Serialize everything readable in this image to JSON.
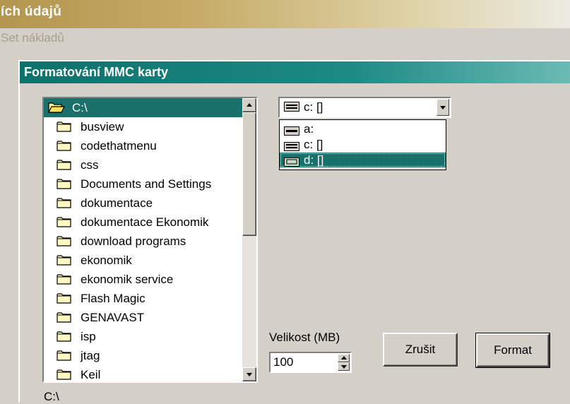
{
  "outer_window": {
    "title": "ích údajů",
    "subtitle": "Set nákladů"
  },
  "dialog": {
    "title": "Formatování MMC karty",
    "current_path": "C:\\"
  },
  "directory_list": {
    "items": [
      {
        "label": "C:\\",
        "icon": "open-folder-icon",
        "selected": true
      },
      {
        "label": "busview",
        "icon": "folder-icon"
      },
      {
        "label": "codethatmenu",
        "icon": "folder-icon"
      },
      {
        "label": "css",
        "icon": "folder-icon"
      },
      {
        "label": "Documents and Settings",
        "icon": "folder-icon"
      },
      {
        "label": "dokumentace",
        "icon": "folder-icon"
      },
      {
        "label": "dokumentace Ekonomik",
        "icon": "folder-icon"
      },
      {
        "label": "download programs",
        "icon": "folder-icon"
      },
      {
        "label": "ekonomik",
        "icon": "folder-icon"
      },
      {
        "label": "ekonomik service",
        "icon": "folder-icon"
      },
      {
        "label": "Flash Magic",
        "icon": "folder-icon"
      },
      {
        "label": "GENAVAST",
        "icon": "folder-icon"
      },
      {
        "label": "isp",
        "icon": "folder-icon"
      },
      {
        "label": "jtag",
        "icon": "folder-icon"
      },
      {
        "label": "Keil",
        "icon": "folder-icon"
      }
    ]
  },
  "drive_combo": {
    "selected": "c: []",
    "options": [
      {
        "label": "a:",
        "icon": "floppy-drive-icon"
      },
      {
        "label": "c: []",
        "icon": "hard-drive-icon"
      },
      {
        "label": "d: []",
        "icon": "removable-drive-icon",
        "highlighted": true
      }
    ]
  },
  "size": {
    "label": "Velikost (MB)",
    "value": "100"
  },
  "buttons": {
    "cancel": "Zrušit",
    "format": "Format"
  },
  "colors": {
    "selection": "#1a716c",
    "dialog_title": "#0e716c",
    "window_title": "#b3964f",
    "face": "#d4d0c8"
  }
}
